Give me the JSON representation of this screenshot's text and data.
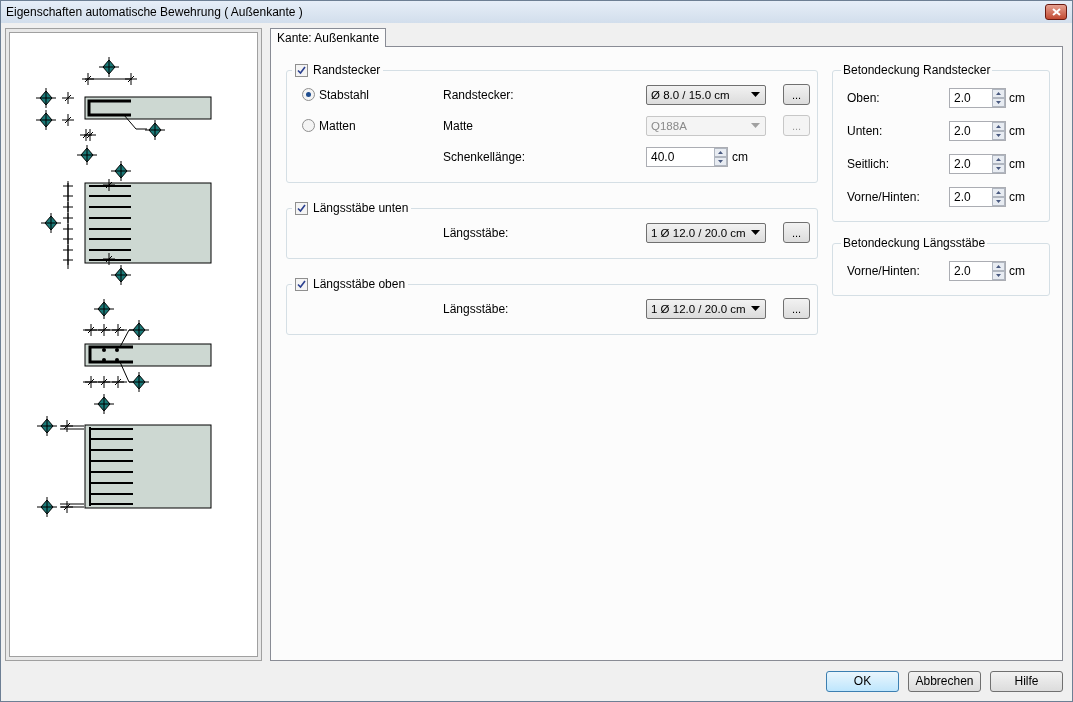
{
  "window": {
    "title": "Eigenschaften automatische Bewehrung ( Außenkante )"
  },
  "tabs": [
    {
      "label": "Kante: Außenkante",
      "selected": true
    }
  ],
  "groups": [
    {
      "title": "Randstecker",
      "checked": true,
      "radios": [
        {
          "label": "Stabstahl",
          "selected": true
        },
        {
          "label": "Matten",
          "selected": false
        }
      ],
      "fields": [
        {
          "kind": "combo",
          "label": "Randstecker:",
          "value": "Ø 8.0 / 15.0 cm",
          "disabled": false,
          "button": "..."
        },
        {
          "kind": "combo",
          "label": "Matte",
          "value": "Q188A",
          "disabled": true,
          "button": "..."
        },
        {
          "kind": "spin",
          "label": "Schenkellänge:",
          "value": "40.0",
          "unit": "cm"
        }
      ]
    },
    {
      "title": "Längsstäbe unten",
      "checked": true,
      "fields": [
        {
          "kind": "combo",
          "label": "Längsstäbe:",
          "value": "1 Ø 12.0 / 20.0 cm",
          "disabled": false,
          "button": "..."
        }
      ]
    },
    {
      "title": "Längsstäbe oben",
      "checked": true,
      "fields": [
        {
          "kind": "combo",
          "label": "Längsstäbe:",
          "value": "1 Ø 12.0 / 20.0 cm",
          "disabled": false,
          "button": "..."
        }
      ]
    }
  ],
  "cover_groups": [
    {
      "title": "Betondeckung Randstecker",
      "fields": [
        {
          "label": "Oben:",
          "value": "2.0",
          "unit": "cm"
        },
        {
          "label": "Unten:",
          "value": "2.0",
          "unit": "cm"
        },
        {
          "label": "Seitlich:",
          "value": "2.0",
          "unit": "cm"
        },
        {
          "label": "Vorne/Hinten:",
          "value": "2.0",
          "unit": "cm"
        }
      ]
    },
    {
      "title": "Betondeckung Längsstäbe",
      "fields": [
        {
          "label": "Vorne/Hinten:",
          "value": "2.0",
          "unit": "cm"
        }
      ]
    }
  ],
  "buttons": [
    {
      "label": "OK",
      "default": true
    },
    {
      "label": "Abbrechen",
      "default": false
    },
    {
      "label": "Hilfe",
      "default": false
    }
  ]
}
